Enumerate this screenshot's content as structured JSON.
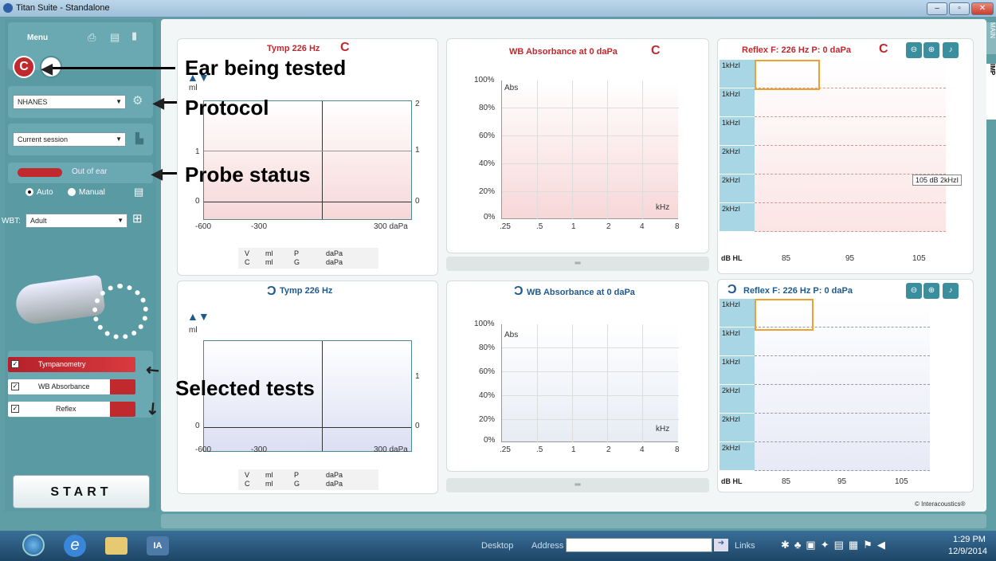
{
  "window": {
    "title": "Titan Suite - Standalone"
  },
  "left": {
    "menu_label": "Menu",
    "protocol": "NHANES",
    "session": "Current session",
    "probe_status": "Out of ear",
    "mode_auto": "Auto",
    "mode_manual": "Manual",
    "wbt_label": "WBT:",
    "wbt_value": "Adult",
    "tests": [
      {
        "label": "Tympanometry"
      },
      {
        "label": "WB Absorbance"
      },
      {
        "label": "Reflex"
      }
    ],
    "start": "START"
  },
  "annotations": {
    "ear": "Ear being tested",
    "protocol": "Protocol",
    "probe": "Probe status",
    "tests": "Selected tests"
  },
  "tymp_right": {
    "title": "Tymp 226 Hz",
    "ylabel": "ml",
    "ticks_x": [
      "-600",
      "-300",
      "300 daPa"
    ],
    "ticks_y": [
      "2",
      "1",
      "0"
    ],
    "ticks_yl": [
      "1",
      "0"
    ],
    "footer": {
      "r1": [
        "V",
        "ml",
        "P",
        "daPa"
      ],
      "r2": [
        "C",
        "ml",
        "G",
        "daPa"
      ]
    }
  },
  "tymp_left": {
    "title": "Tymp 226 Hz",
    "ylabel": "ml",
    "ticks_x": [
      "-600",
      "-300",
      "300 daPa"
    ],
    "ticks_y": [
      "1",
      "0"
    ],
    "ticks_yl": [
      "0"
    ],
    "footer": {
      "r1": [
        "V",
        "ml",
        "P",
        "daPa"
      ],
      "r2": [
        "C",
        "ml",
        "G",
        "daPa"
      ]
    }
  },
  "wba_right": {
    "title": "WB Absorbance at 0 daPa",
    "ylabel": "Abs",
    "xunit": "kHz",
    "ticks_y": [
      "100%",
      "80%",
      "60%",
      "40%",
      "20%",
      "0%"
    ],
    "ticks_x": [
      ".25",
      ".5",
      "1",
      "2",
      "4",
      "8"
    ]
  },
  "wba_left": {
    "title": "WB Absorbance at 0 daPa",
    "ylabel": "Abs",
    "xunit": "kHz",
    "ticks_y": [
      "100%",
      "80%",
      "60%",
      "40%",
      "20%",
      "0%"
    ],
    "ticks_x": [
      ".25",
      ".5",
      "1",
      "2",
      "4",
      "8"
    ]
  },
  "reflex_right": {
    "title": "Reflex  F: 226 Hz P: 0 daPa",
    "rows": [
      "1kHzI",
      "1kHzI",
      "1kHzI",
      "2kHzI",
      "2kHzI",
      "2kHzI"
    ],
    "footer_lbl": "dB HL",
    "cols": [
      "85",
      "95",
      "105"
    ],
    "tooltip": "105 dB 2kHzI"
  },
  "reflex_left": {
    "title": "Reflex  F: 226 Hz P: 0 daPa",
    "rows": [
      "1kHzI",
      "1kHzI",
      "1kHzI",
      "2kHzI",
      "2kHzI",
      "2kHzI"
    ],
    "footer_lbl": "dB HL",
    "cols": [
      "85",
      "95",
      "105"
    ]
  },
  "side_tabs": {
    "main": "MAIN",
    "imp": "IMP"
  },
  "copyright": "© Interacoustics®",
  "taskbar": {
    "desktop": "Desktop",
    "address": "Address",
    "links": "Links",
    "time": "1:29 PM",
    "date": "12/9/2014"
  },
  "colors": {
    "right_ear": "#c0292e",
    "left_ear": "#1f5a8e",
    "teal": "#5a9ba3"
  }
}
